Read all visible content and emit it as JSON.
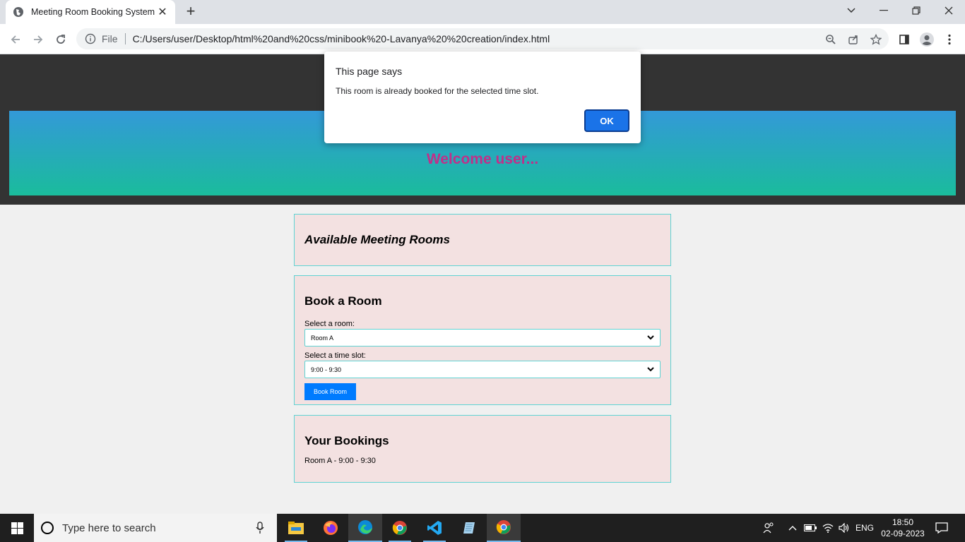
{
  "browser": {
    "tab_title": "Meeting Room Booking System",
    "address_scheme": "File",
    "url": "C:/Users/user/Desktop/html%20and%20css/minibook%20-Lavanya%20%20creation/index.html"
  },
  "page": {
    "welcome": "Welcome user...",
    "available_title": "Available Meeting Rooms",
    "book": {
      "title": "Book a Room",
      "room_label": "Select a room:",
      "room_value": "Room A",
      "slot_label": "Select a time slot:",
      "slot_value": "9:00 - 9:30",
      "button": "Book Room"
    },
    "bookings": {
      "title": "Your Bookings",
      "items": [
        "Room A - 9:00 - 9:30"
      ]
    }
  },
  "dialog": {
    "title": "This page says",
    "message": "This room is already booked for the selected time slot.",
    "ok": "OK"
  },
  "taskbar": {
    "search_placeholder": "Type here to search",
    "language": "ENG",
    "time": "18:50",
    "date": "02-09-2023",
    "apps": [
      "file-explorer-icon",
      "firefox-icon",
      "edge-icon",
      "chrome-icon",
      "vscode-icon",
      "notepad-icon",
      "chrome-icon"
    ]
  },
  "colors": {
    "header": "#333333",
    "banner_top": "#3399d8",
    "banner_bottom": "#1abc9c",
    "welcome_text": "#c0308a",
    "card_bg": "#f3e1e1",
    "card_border": "#5fd3d3",
    "button": "#007bff",
    "dialog_ok": "#1a73e8"
  }
}
